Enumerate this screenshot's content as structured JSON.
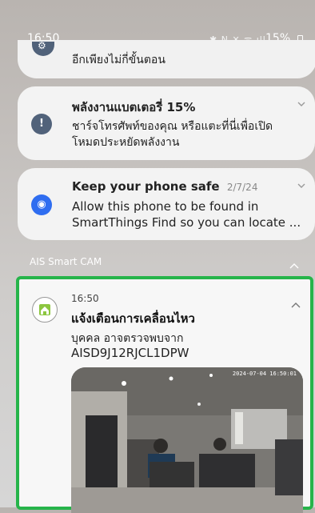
{
  "status_bar": {
    "time": "16:50",
    "icons": "✱ N ✕ ᯤ ıll",
    "battery_percent": "15%"
  },
  "notifications": [
    {
      "text": "อีกเพียงไม่กี่ขั้นตอน",
      "icon": "gear-icon"
    },
    {
      "title": "พลังงานแบตเตอรี่ 15%",
      "body_line1": "ชาร์จโทรศัพท์ของคุณ หรือแตะที่นี่เพื่อเปิด",
      "body_line2": "โหมดประหยัดพลังงาน",
      "icon": "battery-alert-icon"
    },
    {
      "title": "Keep your phone safe",
      "date": "2/7/24",
      "body_line1": "Allow this phone to be found in",
      "body_line2": "SmartThings Find so you can locate ...",
      "icon": "location-icon"
    }
  ],
  "ais_section": {
    "label": "AIS Smart CAM",
    "card": {
      "time": "16:50",
      "title": "แจ้งเตือนการเคลื่อนไหว",
      "line1": "บุคคล อาจตรวจพบจาก",
      "line2": "AISD9J12RJCL1DPW",
      "camera_stamp": "2024-07-04 16:50:01",
      "icon": "home-camera-icon",
      "highlight_color": "#26b44a"
    }
  }
}
